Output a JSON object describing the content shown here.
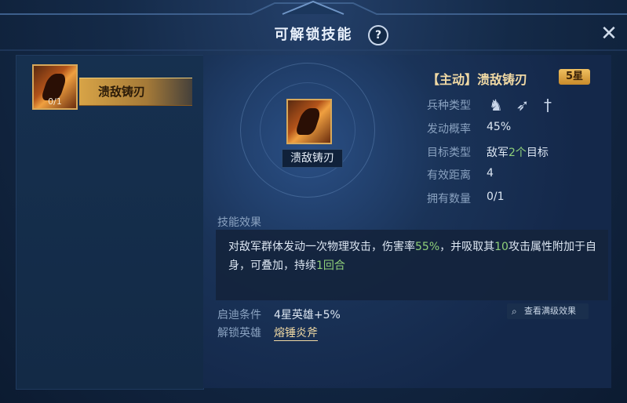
{
  "window": {
    "title": "可解锁技能",
    "help_icon": "question-icon",
    "close_icon": "close-icon"
  },
  "skill_list": [
    {
      "name": "溃敌铸刃",
      "count": "0/1"
    }
  ],
  "preview": {
    "name": "溃敌铸刃"
  },
  "detail": {
    "title": "【主动】溃敌铸刃",
    "star_badge": "5星",
    "troop_type_label": "兵种类型",
    "troop_icons": [
      "cavalry-icon",
      "archer-icon",
      "infantry-icon"
    ],
    "trigger_rate_label": "发动概率",
    "trigger_rate": "45%",
    "target_type_label": "目标类型",
    "target_prefix": "敌军",
    "target_count": "2个",
    "target_suffix": "目标",
    "range_label": "有效距离",
    "range": "4",
    "owned_label": "拥有数量",
    "owned": "0/1"
  },
  "effect": {
    "heading": "技能效果",
    "text_1": "对敌军群体发动一次物理攻击，伤害率",
    "highlight_1": "55%",
    "text_2": "，并吸取其",
    "highlight_2": "10",
    "text_3": "攻击属性附加于自身，可叠加，持续",
    "highlight_3": "1回合"
  },
  "conditions": {
    "enlighten_label": "启迪条件",
    "enlighten_value": "4星英雄+5%",
    "unlock_hero_label": "解锁英雄",
    "unlock_hero_value": "熔锤炎斧",
    "view_max_label": "查看满级效果"
  },
  "colors": {
    "highlight_green": "#8fd07a",
    "gold": "#f0d9a4",
    "bg_dark": "#0d1d33"
  }
}
